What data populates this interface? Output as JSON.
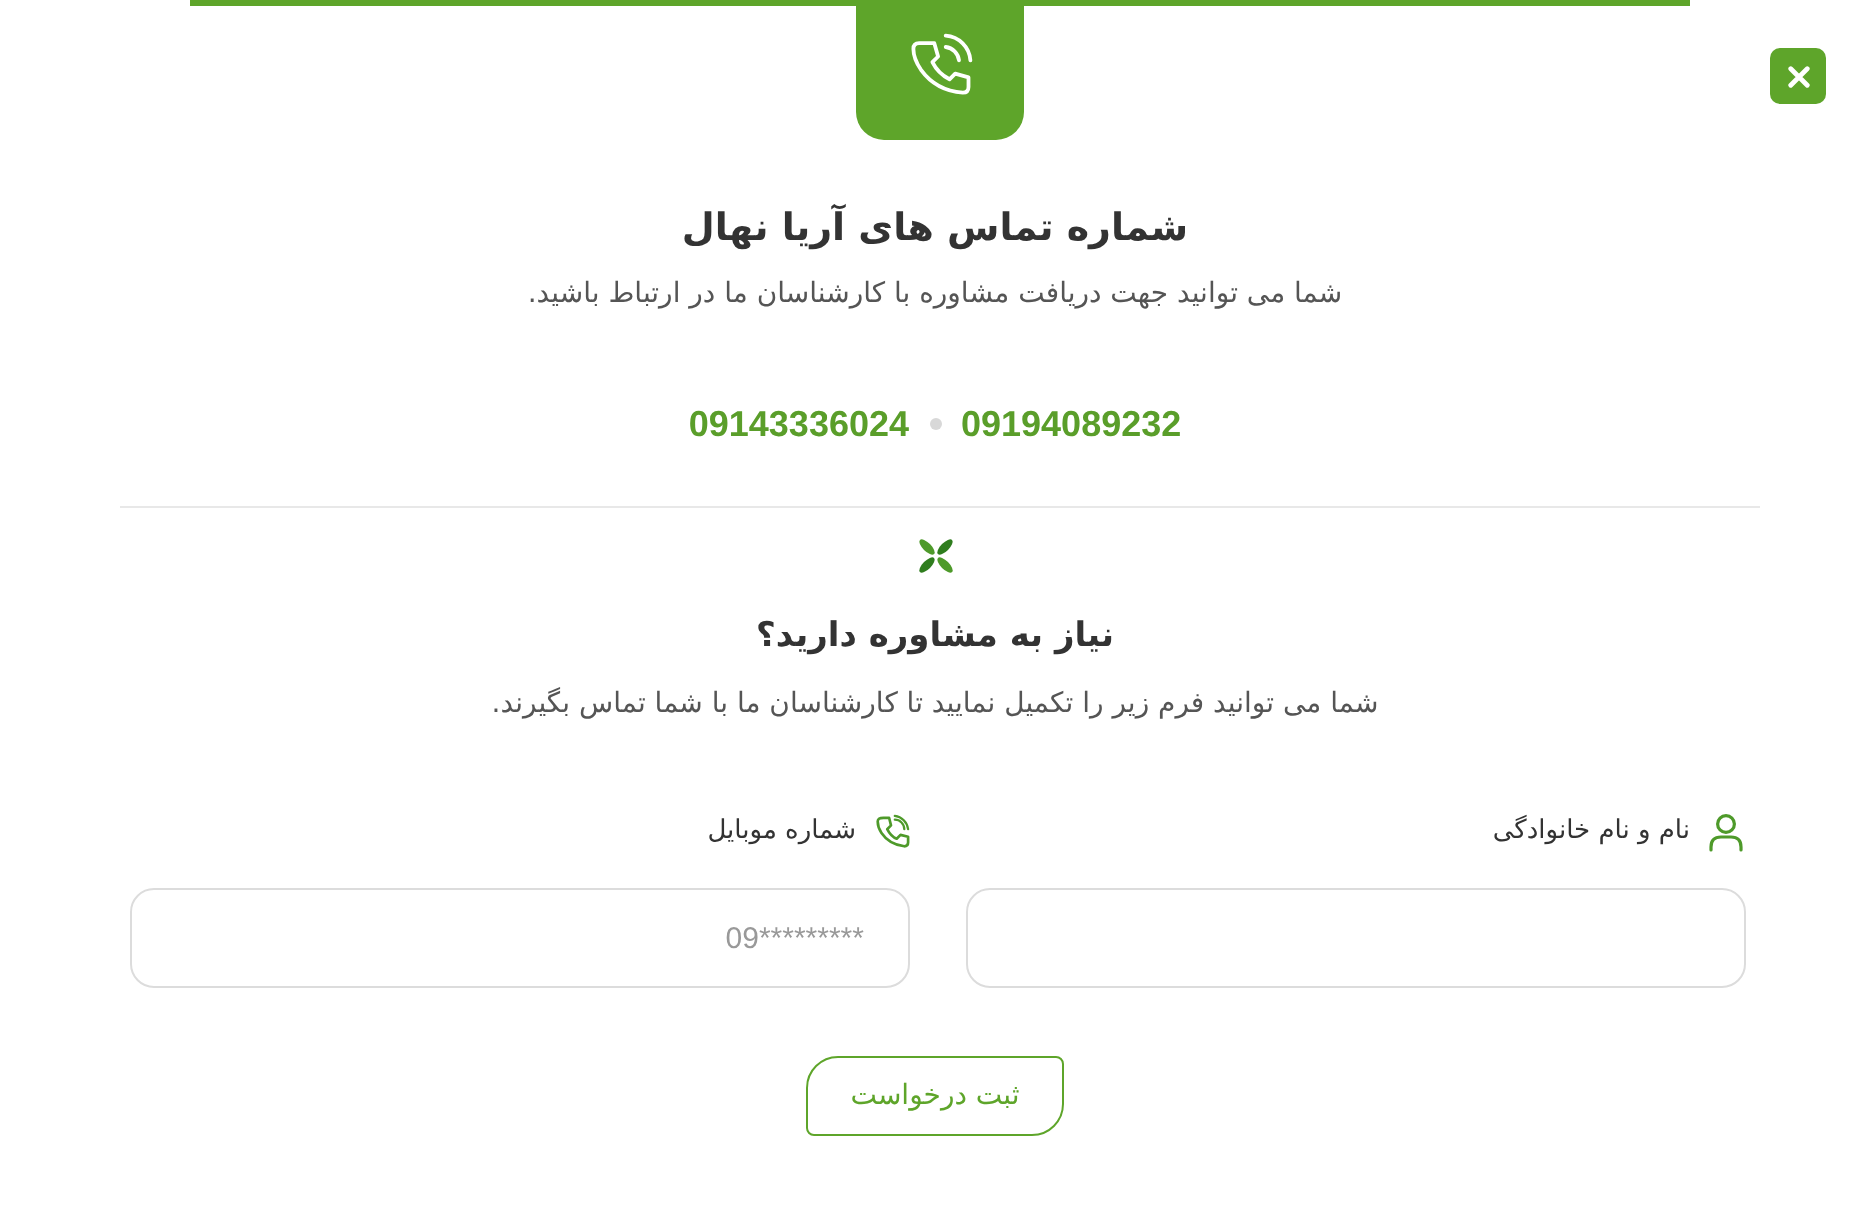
{
  "contact": {
    "title": "شماره تماس های آریا نهال",
    "subtitle": "شما می توانید جهت دریافت مشاوره با کارشناسان ما در ارتباط باشید.",
    "phones": [
      "09194089232",
      "09143336024"
    ]
  },
  "form": {
    "title": "نیاز به مشاوره دارید؟",
    "subtitle": "شما می توانید فرم زیر را تکمیل نمایید تا کارشناسان ما با شما تماس بگیرند.",
    "fields": [
      {
        "kind": "name",
        "label": "نام و نام خانوادگی"
      },
      {
        "kind": "mobile",
        "label": "شماره موبایل",
        "placeholder": "09*********"
      }
    ],
    "submit": "ثبت درخواست"
  }
}
